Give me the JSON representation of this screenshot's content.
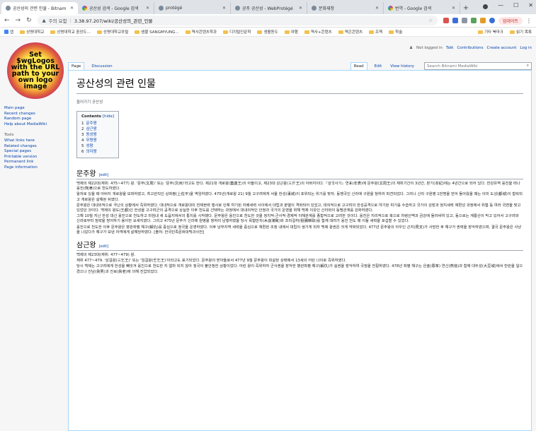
{
  "browser": {
    "tabs": [
      {
        "title": "공산성의 관련 인물 - Bitnam",
        "active": true,
        "favicon": "wiki"
      },
      {
        "title": "공산성 검색 - Google 검색",
        "active": false,
        "favicon": "google"
      },
      {
        "title": "protégé",
        "active": false,
        "favicon": "protege"
      },
      {
        "title": "공주 공산성 - WebProtégé",
        "active": false,
        "favicon": "protege"
      },
      {
        "title": "문화재청",
        "active": false,
        "favicon": "gov"
      },
      {
        "title": "번역 - Google 검색",
        "active": false,
        "favicon": "google"
      }
    ],
    "newtab": "+",
    "address": {
      "warning": "주의 요함",
      "url": "3.38.97.207/wiki/공산성의_관련_인물"
    },
    "update_label": "업데이트",
    "bookmarks": [
      "앱",
      "상명대학교",
      "상명대학교 중앙도...",
      "상명대학교포털",
      "샘물 SANGMYUNG...",
      "역사콘텐츠학과",
      "디지털인문학",
      "생활동도",
      "여행",
      "역사+콘텐츠",
      "역은콘텐츠",
      "프젝",
      "학술",
      "기타 북마크",
      "읽기 목록"
    ]
  },
  "wiki": {
    "logo_text": "Set\n$wgLogos\nwith the URL\npath to your\nown logo\nimage",
    "personal": {
      "not_logged": "Not logged in",
      "links": [
        "Talk",
        "Contributions",
        "Create account",
        "Log in"
      ]
    },
    "nav": {
      "main": [
        "Main page",
        "Recent changes",
        "Random page",
        "Help about MediaWiki"
      ],
      "tools_heading": "Tools",
      "tools": [
        "What links here",
        "Related changes",
        "Special pages",
        "Printable version",
        "Permanent link",
        "Page information"
      ]
    },
    "tabs_left": [
      "Page",
      "Discussion"
    ],
    "tabs_right": [
      "Read",
      "Edit",
      "View history"
    ],
    "search_placeholder": "Search Bitnami MediaWiki",
    "title": "공산성의 관련 인물",
    "redirect_note": "들어가기 공산성",
    "toc": {
      "title": "Contents",
      "hide": "[hide]",
      "items": [
        {
          "n": "1",
          "t": "문주왕"
        },
        {
          "n": "2",
          "t": "삼근왕"
        },
        {
          "n": "3",
          "t": "동성왕"
        },
        {
          "n": "4",
          "t": "무령왕"
        },
        {
          "n": "5",
          "t": "성왕"
        },
        {
          "n": "6",
          "t": "의자왕"
        }
      ]
    },
    "edit_label": "[edit]",
    "sections": [
      {
        "heading": "문주왕",
        "paragraphs": [
          "백제의 제22대(재위: 475~477) 왕. '문주(文周)' 또는 '문주(汶洲)'라고도 한다. 제21대 개로왕(蓋鹵王)의 아들이고, 제23대 삼근왕(三斤王)의 아버지이다.『삼국사기』연표(年表)에 문주왕(文周王)의 재위기간이 3년간, 본기(本紀)에는 4년간으로 되어 있다. 한강유역 웅진을 떠나 웅진(熊津)으로 천도하였다.",
          "왕자로 있을 때 아버지 개로왕을 보좌하였고, 최고관직인 상좌평(上佐平)을 역임하였다. 475년(개로왕 21) 9월 고구려에게 서울 한성(漢城)이 포위되는 위기를 맞자, 동맹국인 신라에 구원을 청하러 파견되었다. 그러나 신라 구원병 1만명을 얻어 돌아왔을 때는 이미 도성(都城)이 함락되고 개로왕은 살해된 뒤였다.",
          "문주왕은 대내외적으로 극난의 상황에서 즉위하였다. 대내적으로 개로왕대의 전제권력 행사로 인해 야기된 지배세력 사이에서 대립과 분열이 격화되어 있었고, 대외적으로 고구려의 한성공격으로 야기된 위기를 수습하고 국가의 성장과 정치세력 재편성 과정에서 위협 등 여러 국면을 맞고 있었던 것이다. 백제의 왕도(王都)인 한성을 고구려군의 공격으로 상실한 이후 천도를 선택하는 과정에서 대내외적인 안정과 국가의 운영을 위해 백제 이웃인 신라와의 동맹관계를 강화하였다.",
          "그해 10월 지난 한성 대신 웅진으로 천도하고 마침내 새 도읍지에서의 통치를 시작했다. 문주왕은 웅진으로 천도한 것을 정치적·군사적·경제적 이해관계를 종합적으로 고려한 것이다. 웅진은 지리적으로 북으로 차령산맥과 금강에 둘러싸여 있고, 동으로는 계룡산이 막고 있어서 고구려와 신라로부터 침략을 방어하기 용이한 요새지였다. 그리고 475년 문주가 신라에 원병을 청하러 남행하였을 당시 목협만치(木劦滿致)와 조미걸취(祖彌桀取)를 함께 데려가 웅진 천도 때 이들 세력을 포섭할 수 있었다.",
          "웅진으로 천도한 이후 문주왕은 병관좌평 해구(解仇)를 중심으로 정국을 운영하였다. 이후 남부지역 세력을 중심으로 재편된 조정 내에서 대립이 생기게 되자 백제 왕권은 크게 약화되었다. 477년 문주왕의 아우인 곤지(昆支)가 사망한 후 해구가 권력을 장악하였으며, 결국 문주왕은 사냥을 나갔다가 해구가 보낸 자객에게 살해당하였다. [출처: 한국민족문화대백과사전]"
        ]
      },
      {
        "heading": "삼근왕",
        "paragraphs": [
          "백제의 제23대(재위: 477~479) 왕.",
          "재위 477~479. '삼걸왕(三乞王)' 또는 '임걸왕(壬乞王)'이라고도 표기되었다. 문주왕의 맏아들로서 477년 9월 문주왕이 피살된 상태에서 13세의 어린 나이로 즉위하였다.",
          "당시 백제는 고구려에게 한성을 빼앗겨 웅진으로 천도한 지 얼마 되지 않아 정국이 불안정한 상황이었다. 어린 왕이 즉위하자 군사권을 장악한 병관좌평 해구(解仇)가 실권을 장악하여 국정을 전횡하였다. 478년 좌평 해구는 은솔(恩率) 연신(燕信)과 함께 대두성(大豆城)에서 반란을 일으켰으나 진남(眞男)과 진로(眞老)에 의해 진압되었다."
        ]
      }
    ]
  }
}
